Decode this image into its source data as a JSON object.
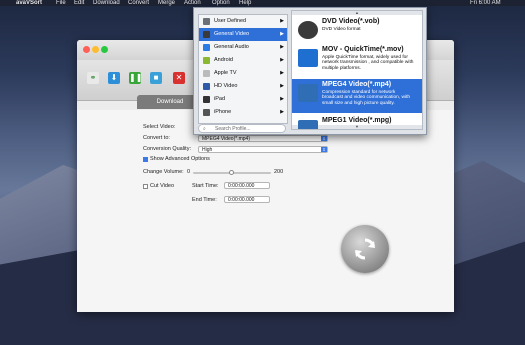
{
  "menubar": {
    "app_name": "avaVSort",
    "items": [
      "File",
      "Edit",
      "Download",
      "Convert",
      "Merge",
      "Action",
      "Option",
      "Help"
    ],
    "right_text": "Fri 6:00 AM"
  },
  "toolbar": {
    "tab_label": "Download"
  },
  "form": {
    "select_video_label": "Select Video:",
    "convert_to_label": "Convert to:",
    "convert_to_value": "MPEG4 Video(*.mp4)",
    "quality_label": "Conversion Quality:",
    "quality_value": "High",
    "advanced_label": "Show Advanced Options",
    "volume_label": "Change Volume:",
    "volume_min": "0",
    "volume_max": "200",
    "cut_label": "Cut Video",
    "start_label": "Start Time:",
    "start_value": "0:00:00.000",
    "end_label": "End Time:",
    "end_value": "0:00:00.000"
  },
  "popup": {
    "categories": [
      {
        "label": "User Defined",
        "icon": "user-icon",
        "color": "#6b6f78"
      },
      {
        "label": "General Video",
        "icon": "film-icon",
        "color": "#3a3a3a"
      },
      {
        "label": "General Audio",
        "icon": "music-note-icon",
        "color": "#2c7be5"
      },
      {
        "label": "Android",
        "icon": "android-icon",
        "color": "#8ab833"
      },
      {
        "label": "Apple TV",
        "icon": "apple-tv-icon",
        "color": "#bbbbbb"
      },
      {
        "label": "HD Video",
        "icon": "hd-icon",
        "color": "#2f5aa8"
      },
      {
        "label": "iPad",
        "icon": "ipad-icon",
        "color": "#333333"
      },
      {
        "label": "iPhone",
        "icon": "iphone-icon",
        "color": "#555555"
      }
    ],
    "active_category": 1,
    "search_placeholder": "Search Profile...",
    "formats": [
      {
        "name": "DVD Video(*.vob)",
        "desc": "DVD Video format",
        "icon": "dvd-icon"
      },
      {
        "name": "MOV - QuickTime(*.mov)",
        "desc": "Apple QuickTime format, widely used for network transmission , and compatible with multiple platforms.",
        "icon": "quicktime-icon"
      },
      {
        "name": "MPEG4 Video(*.mp4)",
        "desc": "Compression standard for network broadcast and video communication, with small size and high picture quality.",
        "icon": "mpeg4-icon"
      },
      {
        "name": "MPEG1 Video(*.mpg)",
        "desc": "",
        "icon": "mpeg1-icon"
      }
    ],
    "active_format": 2
  },
  "colors": {
    "accent": "#2e6fd8",
    "close": "#d9312f",
    "download": "#2d8fd8",
    "pause": "#3aa63a",
    "stop": "#3aa0d8"
  }
}
